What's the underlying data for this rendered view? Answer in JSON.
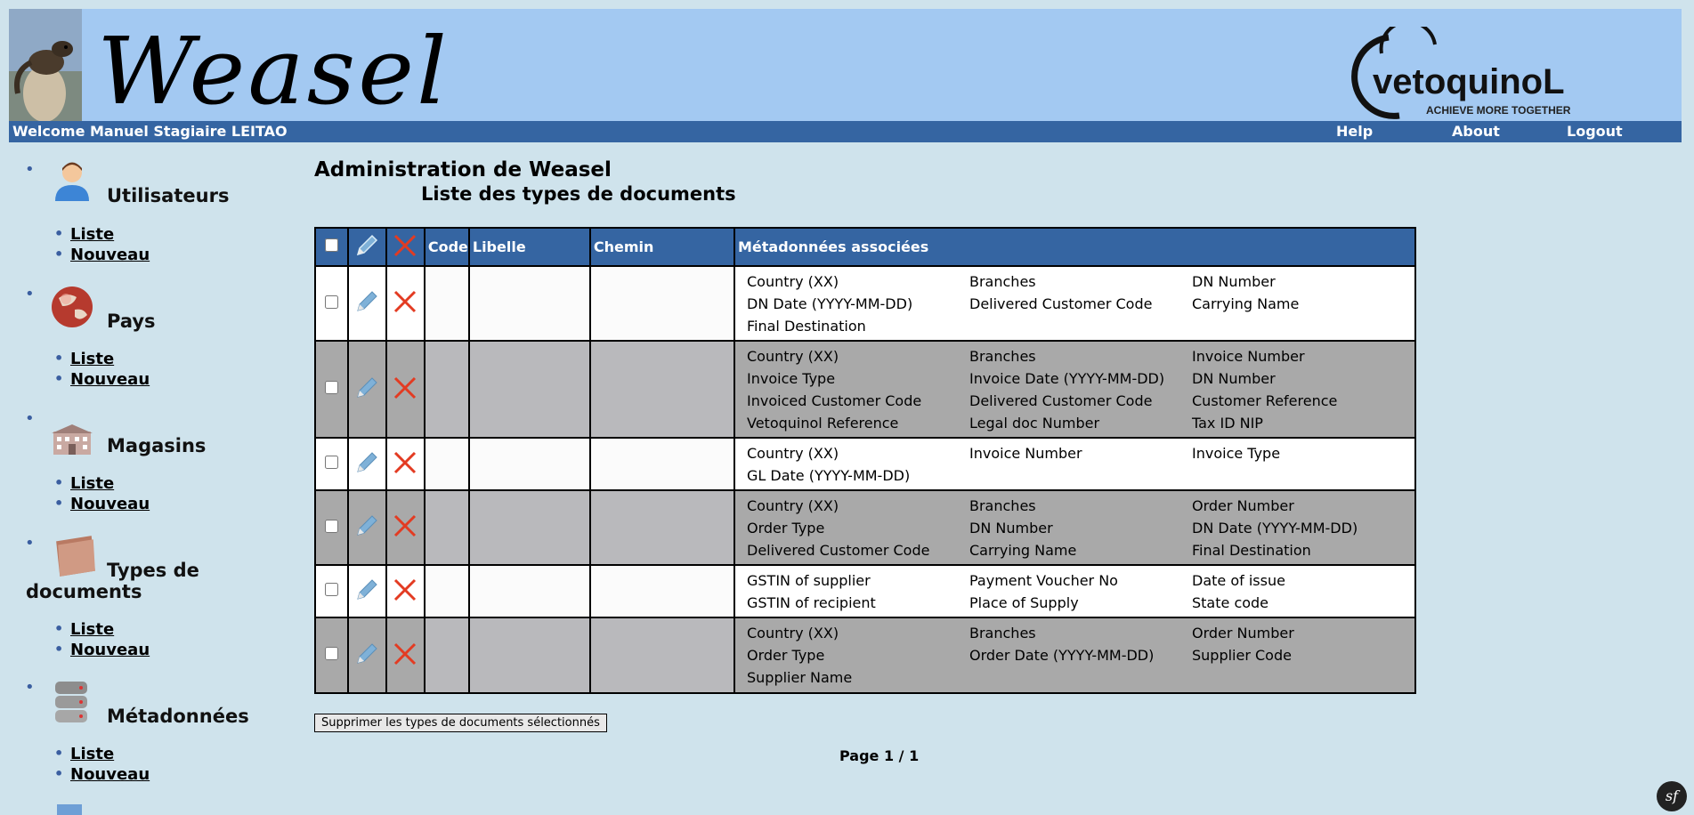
{
  "header": {
    "brand": "Weasel",
    "company_logo_text": "vetoquinoL",
    "company_tagline": "ACHIEVE MORE TOGETHER",
    "welcome": "Welcome Manuel Stagiaire LEITAO",
    "nav": {
      "help": "Help",
      "about": "About",
      "logout": "Logout"
    }
  },
  "sidebar": {
    "sections": [
      {
        "title": "Utilisateurs",
        "icon": "user-icon",
        "links": [
          "Liste",
          "Nouveau"
        ]
      },
      {
        "title": "Pays",
        "icon": "globe-icon",
        "links": [
          "Liste",
          "Nouveau"
        ]
      },
      {
        "title": "Magasins",
        "icon": "building-icon",
        "links": [
          "Liste",
          "Nouveau"
        ]
      },
      {
        "title_line1": "Types de",
        "title_line2": "documents",
        "icon": "folder-icon",
        "links": [
          "Liste",
          "Nouveau"
        ]
      },
      {
        "title": "Métadonnées",
        "icon": "database-icon",
        "links": [
          "Liste",
          "Nouveau"
        ]
      }
    ]
  },
  "main": {
    "title": "Administration de Weasel",
    "subtitle": "Liste des types de documents",
    "table": {
      "headers": {
        "code": "Code",
        "libelle": "Libelle",
        "chemin": "Chemin",
        "metadata": "Métadonnées associées"
      },
      "rows": [
        {
          "metadata": [
            "Country (XX)",
            "Branches",
            "DN Number",
            "DN Date (YYYY-MM-DD)",
            "Delivered Customer Code",
            "Carrying Name",
            "Final Destination"
          ]
        },
        {
          "metadata": [
            "Country (XX)",
            "Branches",
            "Invoice Number",
            "Invoice Type",
            "Invoice Date (YYYY-MM-DD)",
            "DN Number",
            "Invoiced Customer Code",
            "Delivered Customer Code",
            "Customer Reference",
            "Vetoquinol Reference",
            "Legal doc Number",
            "Tax ID NIP"
          ]
        },
        {
          "metadata": [
            "Country (XX)",
            "Invoice Number",
            "Invoice Type",
            "GL Date (YYYY-MM-DD)"
          ]
        },
        {
          "metadata": [
            "Country (XX)",
            "Branches",
            "Order Number",
            "Order Type",
            "DN Number",
            "DN Date (YYYY-MM-DD)",
            "Delivered Customer Code",
            "Carrying Name",
            "Final Destination"
          ]
        },
        {
          "metadata": [
            "GSTIN of supplier",
            "Payment Voucher No",
            "Date of issue",
            "GSTIN of recipient",
            "Place of Supply",
            "State code"
          ]
        },
        {
          "metadata": [
            "Country (XX)",
            "Branches",
            "Order Number",
            "Order Type",
            "Order Date (YYYY-MM-DD)",
            "Supplier Code",
            "Supplier Name"
          ]
        }
      ]
    },
    "delete_button": "Supprimer les types de documents sélectionnés",
    "pagination": "Page 1 / 1"
  },
  "colors": {
    "header_bg": "#a3c9f2",
    "bar_bg": "#3565a2",
    "page_bg": "#cfe3ec",
    "row_gray": "#a9a9a9"
  }
}
